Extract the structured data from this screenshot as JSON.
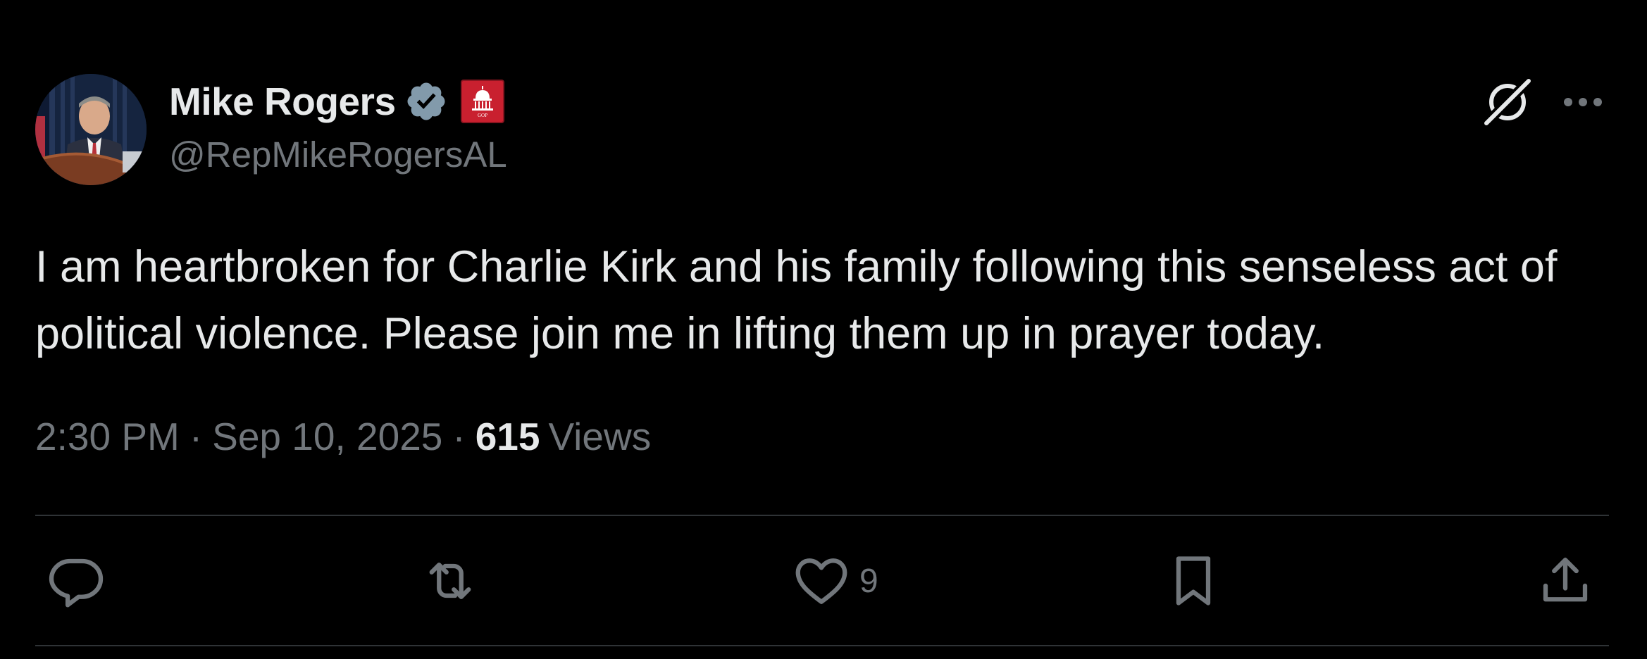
{
  "tweet": {
    "author": {
      "display_name": "Mike Rogers",
      "handle": "@RepMikeRogersAL",
      "verified": true,
      "affiliate_badge": "house-gop-badge",
      "affiliate_badge_text": "GOP"
    },
    "text": "I am heartbroken for Charlie Kirk and his family following this senseless act of political violence. Please join me in lifting them up in prayer today.",
    "time": "2:30 PM",
    "date": "Sep 10, 2025",
    "separator": "·",
    "views_count": "615",
    "views_label": "Views"
  },
  "actions": {
    "reply_icon": "reply-icon",
    "repost_icon": "repost-icon",
    "like_icon": "heart-icon",
    "like_count": "9",
    "bookmark_icon": "bookmark-icon",
    "share_icon": "share-icon"
  },
  "header_icons": {
    "grok": "grok-icon",
    "more": "more-icon"
  },
  "colors": {
    "background": "#000000",
    "text_primary": "#e7e9ea",
    "text_secondary": "#71767b",
    "divider": "#2f3336",
    "verified_badge": "#829aab",
    "affiliate_badge": "#c9202f"
  }
}
